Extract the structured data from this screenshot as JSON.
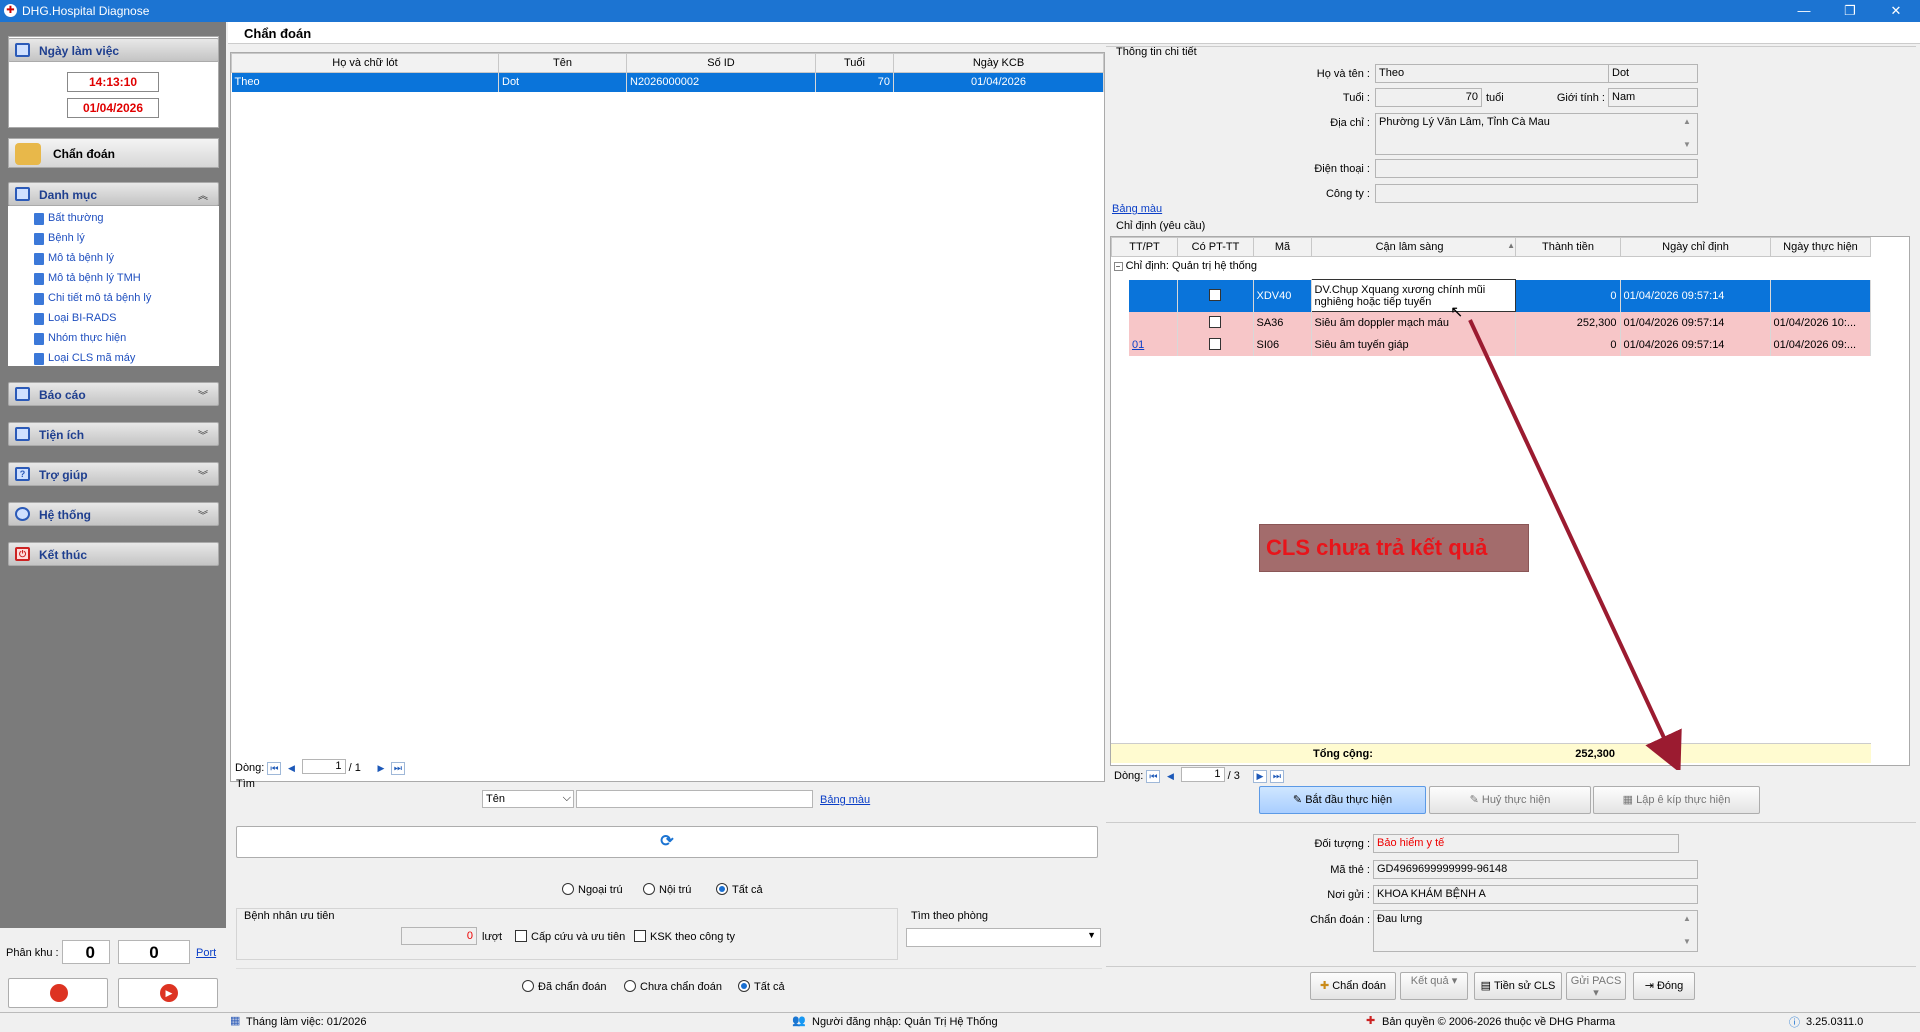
{
  "window": {
    "title": "DHG.Hospital Diagnose",
    "minimize": "—",
    "restore": "❐",
    "close": "✕"
  },
  "sidebar": {
    "work_day": {
      "label": "Ngày làm việc",
      "time": "14:13:10",
      "date": "01/04/2026"
    },
    "diagnose_label": "Chẩn đoán",
    "catalog": {
      "label": "Danh mục",
      "items": [
        "Bất thường",
        "Bệnh lý",
        "Mô tả bệnh lý",
        "Mô tả bệnh lý TMH",
        "Chi tiết mô tả bệnh lý",
        "Loại BI-RADS",
        "Nhóm thực hiện",
        "Loại CLS mã máy"
      ]
    },
    "reports": "Báo cáo",
    "utilities": "Tiện ích",
    "help": "Trợ giúp",
    "system": "Hệ thống",
    "exit": "Kết thúc",
    "zone_label": "Phân khu :",
    "zone_value1": "0",
    "zone_value2": "0",
    "port_label": "Port"
  },
  "tab": {
    "label": "Chẩn đoán"
  },
  "patient_table": {
    "columns": [
      "Họ và chữ lót",
      "Tên",
      "Số ID",
      "Tuổi",
      "Ngày KCB"
    ],
    "rows": [
      [
        "Theo",
        "Dot",
        "N2026000002",
        "70",
        "01/04/2026"
      ]
    ],
    "pager_label": "Dòng:",
    "pager_current": "1",
    "pager_total": "1"
  },
  "search": {
    "group_label": "Tìm",
    "field_value": "Tên",
    "color_table_link": "Bảng màu",
    "refresh_icon": "⟳",
    "radios": [
      "Ngoại trú",
      "Nội trú",
      "Tất cả"
    ],
    "radio_selected": "Tất cả"
  },
  "priority": {
    "group_label": "Bệnh nhân ưu tiên",
    "count": "0",
    "unit": "lượt",
    "emergency_label": "Cấp cứu và ưu tiên",
    "ksk_label": "KSK theo công ty"
  },
  "room_search": {
    "label": "Tìm theo phòng",
    "value": ""
  },
  "diag_radios": {
    "options": [
      "Đã chẩn đoán",
      "Chưa chẩn đoán",
      "Tất cả"
    ],
    "selected": "Tất cả"
  },
  "detail": {
    "group_label": "Thông tin chi tiết",
    "name_label": "Họ và tên :",
    "first_name": "Theo",
    "last_name": "Dot",
    "age_label": "Tuổi :",
    "age": "70",
    "age_unit": "tuổi",
    "gender_label": "Giới tính :",
    "gender": "Nam",
    "address_label": "Địa chỉ :",
    "address": "Phường Lý Văn Lâm, Tỉnh Cà Mau",
    "phone_label": "Điện thoại :",
    "phone": "",
    "company_label": "Công ty :",
    "company": "",
    "color_link": "Bảng màu"
  },
  "orders": {
    "group_label": "Chỉ định (yêu cầu)",
    "columns": [
      "TT/PT",
      "Có PT-TT",
      "Mã",
      "Cận lâm sàng",
      "Thành tiền",
      "Ngày chỉ định",
      "Ngày thực hiện"
    ],
    "group_row": "Chỉ định:  Quản trị hệ thống",
    "rows": [
      {
        "tt": "",
        "code": "XDV40",
        "name": "DV.Chụp Xquang xương chính mũi nghiêng hoặc tiếp tuyến",
        "amount": "0",
        "order_date": "01/04/2026 09:57:14",
        "done_date": ""
      },
      {
        "tt": "",
        "code": "SA36",
        "name": "Siêu âm doppler mạch máu",
        "amount": "252,300",
        "order_date": "01/04/2026 09:57:14",
        "done_date": "01/04/2026 10:..."
      },
      {
        "tt": "01",
        "code": "SI06",
        "name": "Siêu âm tuyến giáp",
        "amount": "0",
        "order_date": "01/04/2026 09:57:14",
        "done_date": "01/04/2026 09:..."
      }
    ],
    "total_label": "Tổng cộng:",
    "total_value": "252,300",
    "pager_label": "Dòng:",
    "pager_current": "1",
    "pager_total": "3",
    "annotation": "CLS chưa trả kết quả",
    "annotation_color": "#a36c6c",
    "arrow_color": "#9b1b30"
  },
  "actions": {
    "start": "Bắt đầu thực hiện",
    "cancel": "Huỷ thực hiện",
    "crew": "Lập ê kíp thực hiện"
  },
  "insurance": {
    "object_label": "Đối tượng :",
    "object_value": "Bảo hiểm y tế",
    "card_label": "Mã thẻ :",
    "card_value": "GD4969699999999-96148",
    "from_label": "Nơi gửi :",
    "from_value": "KHOA KHÁM BỆNH A",
    "diag_label": "Chẩn đoán :",
    "diag_value": "Đau lưng"
  },
  "bottom_buttons": {
    "diagnose": "Chẩn đoán",
    "result": "Kết quả",
    "history": "Tiền sử CLS",
    "pacs": "Gửi PACS",
    "close": "Đóng"
  },
  "status": {
    "month": "Tháng làm việc: 01/2026",
    "user": "Người đăng nhập: Quản Trị Hệ Thống",
    "copyright": "Bản quyền © 2006-2026 thuộc về DHG Pharma",
    "version": "3.25.0311.0"
  }
}
